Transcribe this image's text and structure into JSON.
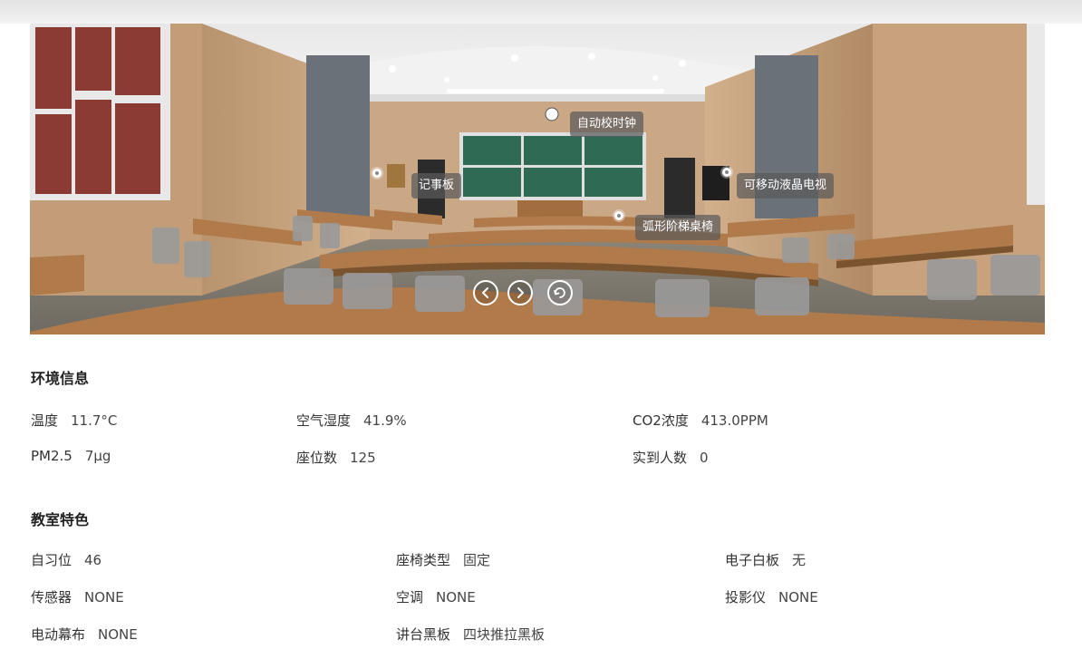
{
  "hotspots": {
    "clock": "自动校时钟",
    "notice_board": "记事板",
    "tv": "可移动液晶电视",
    "desks": "弧形阶梯桌椅"
  },
  "viewer_controls": [
    "previous",
    "next",
    "rotate"
  ],
  "environment": {
    "title": "环境信息",
    "items": [
      {
        "label": "温度",
        "value": "11.7°C"
      },
      {
        "label": "空气湿度",
        "value": "41.9%"
      },
      {
        "label": "CO2浓度",
        "value": "413.0PPM"
      },
      {
        "label": "PM2.5",
        "value": "7μg"
      },
      {
        "label": "座位数",
        "value": "125"
      },
      {
        "label": "实到人数",
        "value": "0"
      }
    ]
  },
  "features": {
    "title": "教室特色",
    "items": [
      {
        "label": "自习位",
        "value": "46"
      },
      {
        "label": "座椅类型",
        "value": "固定"
      },
      {
        "label": "电子白板",
        "value": "无"
      },
      {
        "label": "传感器",
        "value": "NONE"
      },
      {
        "label": "空调",
        "value": "NONE"
      },
      {
        "label": "投影仪",
        "value": "NONE"
      },
      {
        "label": "电动幕布",
        "value": "NONE"
      },
      {
        "label": "讲台黑板",
        "value": "四块推拉黑板"
      }
    ]
  },
  "colors": {
    "label_bg": "#5a5a5a",
    "desk": "#b07a4a",
    "wall": "#c9a682",
    "board": "#2f6a55"
  }
}
